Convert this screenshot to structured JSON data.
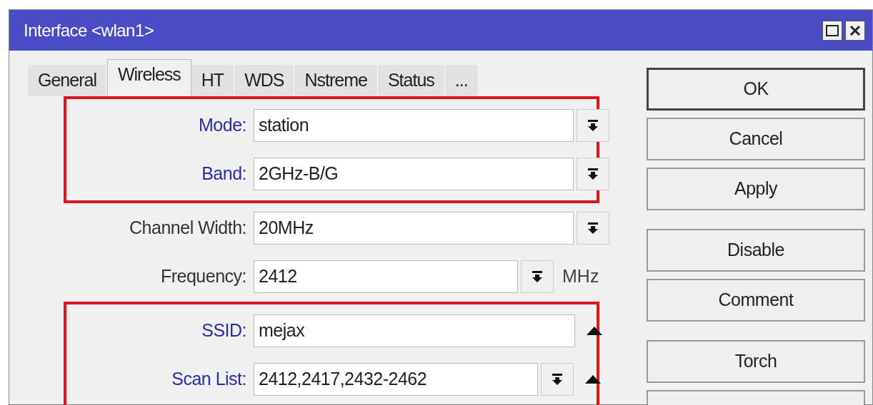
{
  "window": {
    "title": "Interface <wlan1>"
  },
  "tabs": [
    {
      "label": "General",
      "selected": false
    },
    {
      "label": "Wireless",
      "selected": true
    },
    {
      "label": "HT",
      "selected": false
    },
    {
      "label": "WDS",
      "selected": false
    },
    {
      "label": "Nstreme",
      "selected": false
    },
    {
      "label": "Status",
      "selected": false
    },
    {
      "label": "...",
      "selected": false
    }
  ],
  "groups": [
    {
      "highlighted": true,
      "rows": [
        {
          "label": "Mode:",
          "emphasized": true,
          "value": "station",
          "kind": "dropdown"
        },
        {
          "label": "Band:",
          "emphasized": true,
          "value": "2GHz-B/G",
          "kind": "dropdown"
        }
      ]
    },
    {
      "highlighted": false,
      "rows": [
        {
          "label": "Channel Width:",
          "emphasized": false,
          "value": "20MHz",
          "kind": "dropdown"
        },
        {
          "label": "Frequency:",
          "emphasized": false,
          "value": "2412",
          "kind": "dropdown_unit",
          "unit": "MHz"
        }
      ]
    },
    {
      "highlighted": true,
      "rows": [
        {
          "label": "SSID:",
          "emphasized": true,
          "value": "mejax",
          "kind": "collapse"
        },
        {
          "label": "Scan List:",
          "emphasized": true,
          "value": "2412,2417,2432-2462",
          "kind": "dropdown_collapse"
        }
      ]
    }
  ],
  "buttons": [
    {
      "label": "OK",
      "default": true
    },
    {
      "label": "Cancel",
      "default": false
    },
    {
      "label": "Apply",
      "default": false
    },
    {
      "label": "Disable",
      "default": false
    },
    {
      "label": "Comment",
      "default": false
    },
    {
      "label": "Torch",
      "default": false
    },
    {
      "default": false
    }
  ]
}
